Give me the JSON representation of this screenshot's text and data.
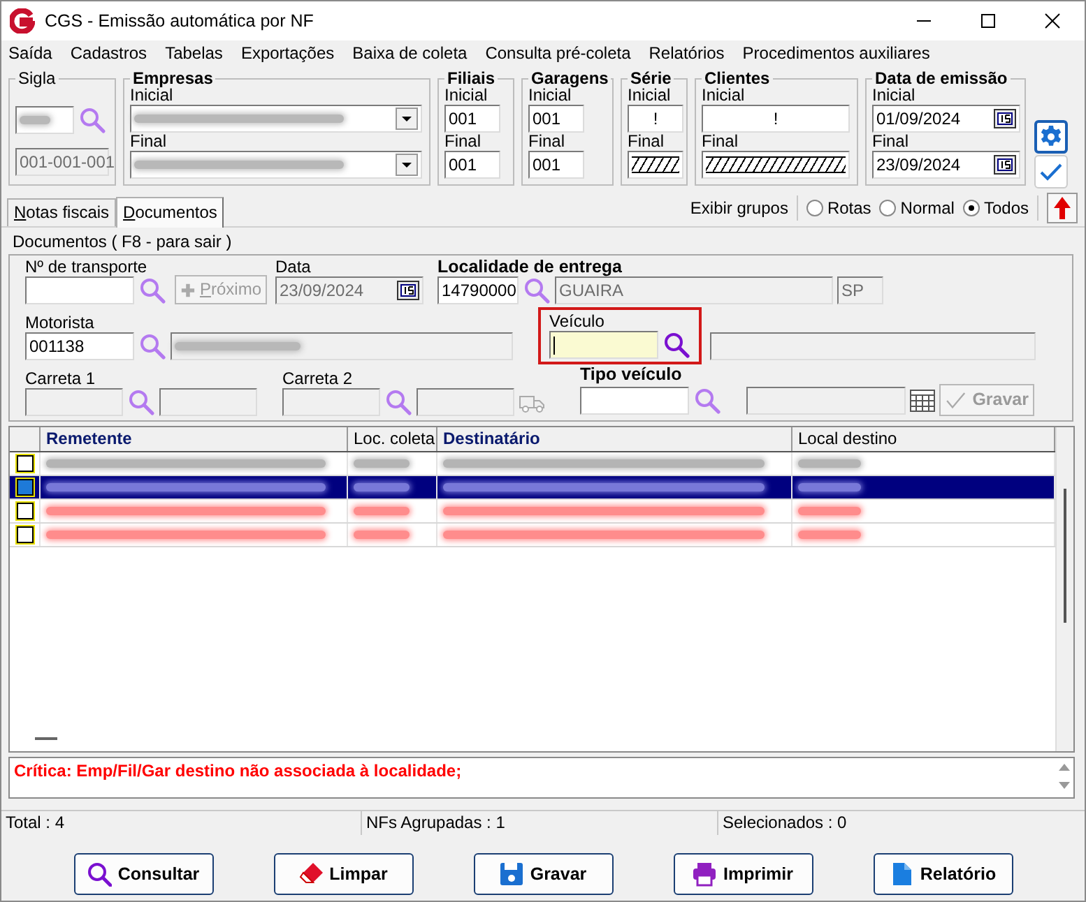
{
  "window": {
    "title": "CGS - Emissão automática por NF"
  },
  "menu": [
    "Saída",
    "Cadastros",
    "Tabelas",
    "Exportações",
    "Baixa de coleta",
    "Consulta pré-coleta",
    "Relatórios",
    "Procedimentos auxiliares"
  ],
  "filters": {
    "sigla": {
      "label": "Sigla",
      "code": "001-001-001"
    },
    "groups": [
      {
        "label": "Empresas",
        "kind": "combo",
        "initial_label": "Inicial",
        "final_label": "Final"
      },
      {
        "label": "Filiais",
        "kind": "text",
        "initial_label": "Inicial",
        "initial": "001",
        "final_label": "Final",
        "final": "001"
      },
      {
        "label": "Garagens",
        "kind": "text",
        "initial_label": "Inicial",
        "initial": "001",
        "final_label": "Final",
        "final": "001"
      },
      {
        "label": "Série",
        "kind": "mask",
        "initial_label": "Inicial",
        "initial": "!",
        "final_label": "Final"
      },
      {
        "label": "Clientes",
        "kind": "mask",
        "initial_label": "Inicial",
        "initial": "!",
        "final_label": "Final"
      },
      {
        "label": "Data de emissão",
        "kind": "date",
        "initial_label": "Inicial",
        "initial": "01/09/2024",
        "final_label": "Final",
        "final": "23/09/2024"
      }
    ]
  },
  "tabs": [
    {
      "label": "Notas fiscais",
      "selected": false
    },
    {
      "label": "Documentos",
      "selected": true
    }
  ],
  "group_display": {
    "label": "Exibir grupos",
    "options": [
      {
        "label": "Rotas",
        "selected": false
      },
      {
        "label": "Normal",
        "selected": false
      },
      {
        "label": "Todos",
        "selected": true
      }
    ]
  },
  "documents": {
    "caption": "Documentos ( F8 - para sair )",
    "transport": {
      "label": "Nº de transporte"
    },
    "next_button": {
      "label": "Próximo",
      "disabled": true
    },
    "date": {
      "label": "Data",
      "value": "23/09/2024"
    },
    "locality": {
      "label": "Localidade de entrega",
      "code": "14790000",
      "city": "GUAIRA",
      "state": "SP"
    },
    "driver": {
      "label": "Motorista",
      "code": "001138"
    },
    "vehicle": {
      "label": "Veículo",
      "focused": true
    },
    "trailer_1": {
      "label": "Carreta 1"
    },
    "trailer_2": {
      "label": "Carreta 2"
    },
    "vehicle_type": {
      "label": "Tipo veículo"
    },
    "save_button": {
      "label": "Gravar",
      "disabled": true
    }
  },
  "grid": {
    "columns": [
      {
        "label": "Remetente",
        "highlighted": true
      },
      {
        "label": "Loc. coleta",
        "highlighted": false
      },
      {
        "label": "Destinatário",
        "highlighted": true
      },
      {
        "label": "Local destino",
        "highlighted": false
      }
    ],
    "rows": [
      {
        "checked": false,
        "selected": false,
        "color": "#b4b4b4"
      },
      {
        "checked": false,
        "selected": true,
        "color": "#7878d8"
      },
      {
        "checked": false,
        "selected": false,
        "color": "#ff8c8c"
      },
      {
        "checked": false,
        "selected": false,
        "color": "#ff8c8c"
      }
    ]
  },
  "message": "Crítica: Emp/Fil/Gar destino não associada à localidade;",
  "status_bar": [
    "Total : 4",
    "NFs Agrupadas : 1",
    "Selecionados : 0"
  ],
  "buttons": [
    {
      "label": "Consultar",
      "kind": "search"
    },
    {
      "label": "Limpar",
      "kind": "eraser"
    },
    {
      "label": "Gravar",
      "kind": "save"
    },
    {
      "label": "Imprimir",
      "kind": "print"
    },
    {
      "label": "Relatório",
      "kind": "report"
    }
  ]
}
